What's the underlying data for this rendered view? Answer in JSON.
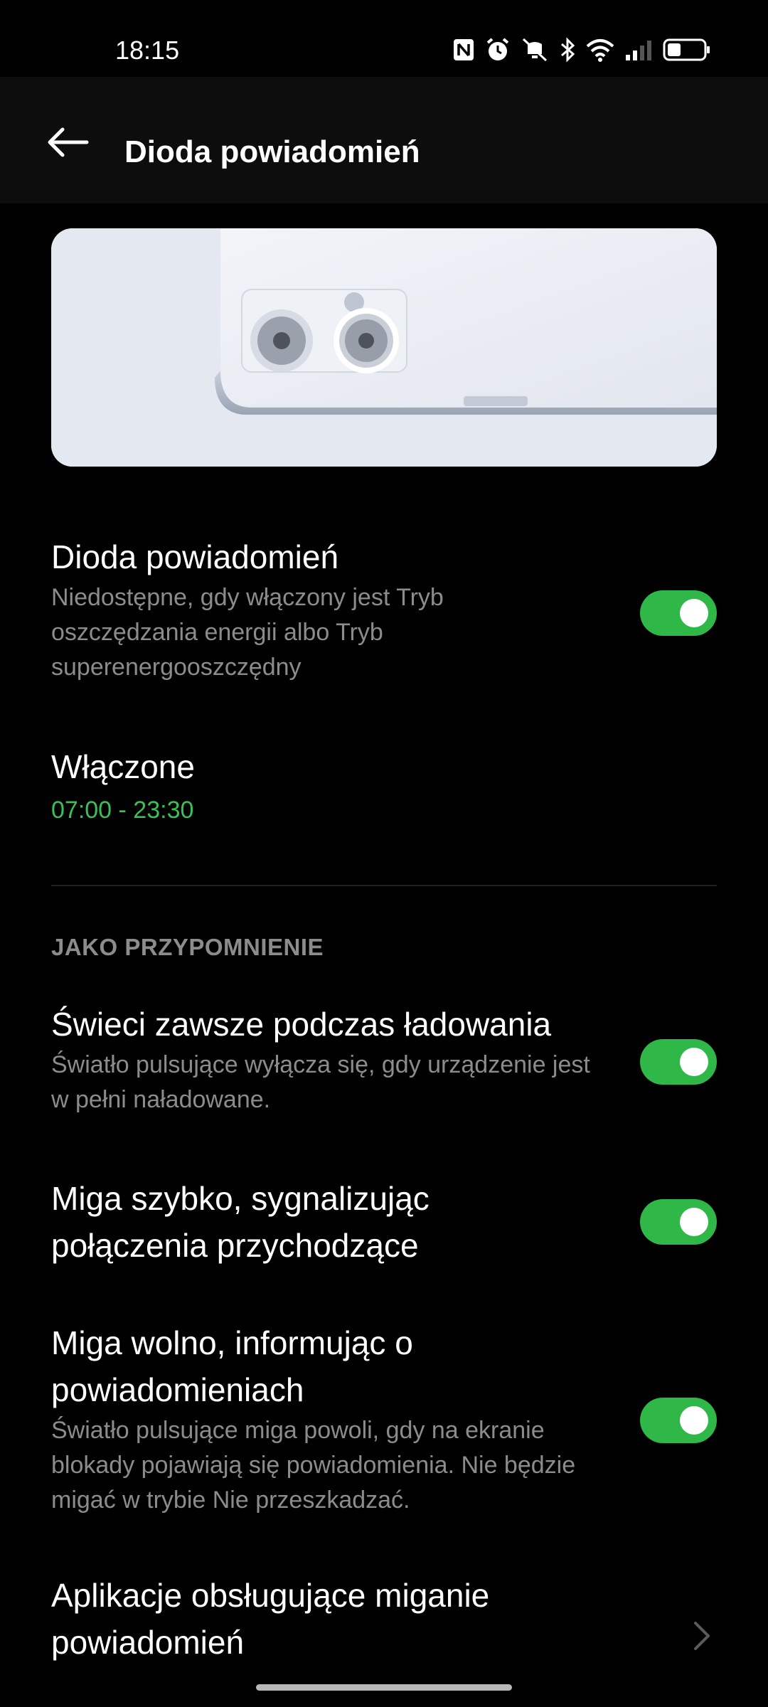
{
  "status_bar": {
    "time": "18:15",
    "icons": [
      "nfc-icon",
      "alarm-icon",
      "vibrate-off-icon",
      "bluetooth-icon",
      "wifi-icon",
      "signal-icon",
      "battery-icon"
    ]
  },
  "app_bar": {
    "title": "Dioda powiadomień",
    "back_icon": "arrow-left-icon"
  },
  "settings": {
    "led": {
      "title": "Dioda powiadomień",
      "description": "Niedostępne, gdy włączony jest Tryb oszczędzania energii albo Tryb superenergooszczędny",
      "enabled": true
    },
    "schedule": {
      "title": "Włączone",
      "value": "07:00  - 23:30"
    }
  },
  "section_reminder": {
    "header": "JAKO PRZYPOMNIENIE",
    "items": [
      {
        "title": "Świeci zawsze podczas ładowania",
        "description": "Światło pulsujące wyłącza się, gdy urządzenie jest w pełni naładowane.",
        "enabled": true
      },
      {
        "title": "Miga szybko, sygnalizując połączenia przychodzące",
        "description": "",
        "enabled": true
      },
      {
        "title": "Miga wolno, informując o powiadomieniach",
        "description": "Światło pulsujące miga powoli, gdy na ekranie blokady pojawiają się powiadomienia. Nie będzie migać w trybie Nie przeszkadzać.",
        "enabled": true
      }
    ],
    "apps_link": {
      "title": "Aplikacje obsługujące miganie powiadomień"
    }
  },
  "colors": {
    "accent": "#2fb748",
    "background": "#000000",
    "secondary_text": "#8c8c8c"
  }
}
